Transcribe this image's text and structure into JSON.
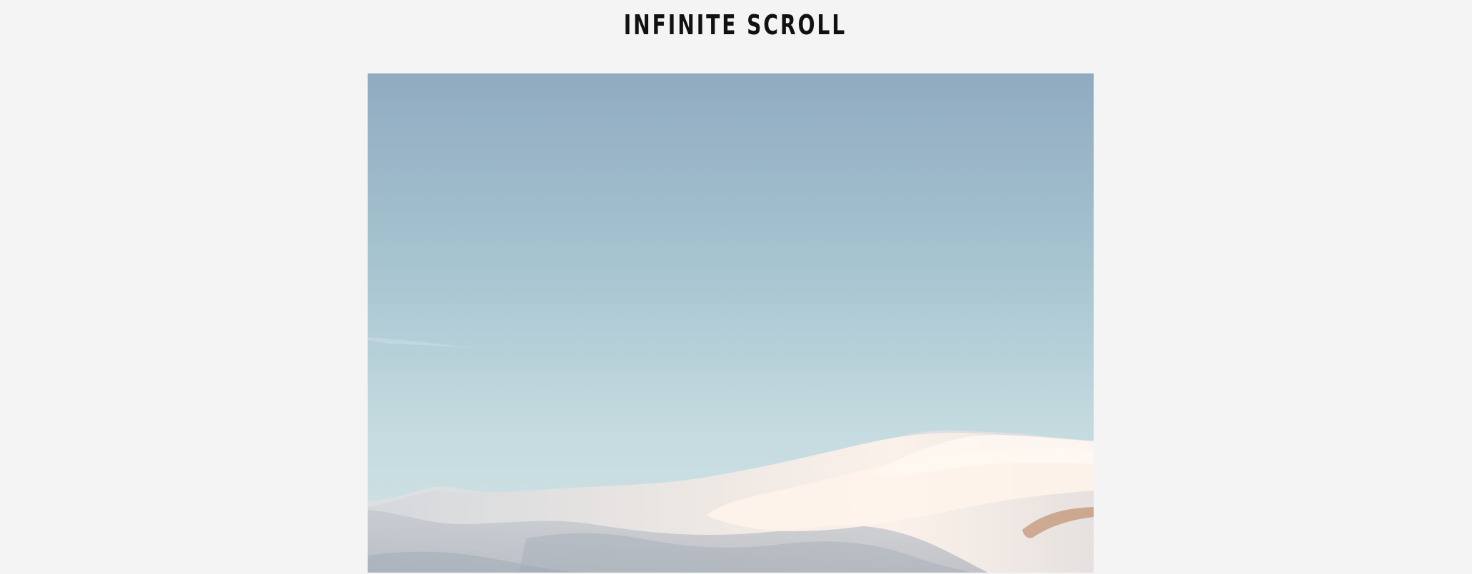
{
  "header": {
    "title": "INFINITE SCROLL"
  },
  "feed": {
    "items": [
      {
        "kind": "photo",
        "subject": "snowy-mountain-landscape"
      }
    ]
  },
  "colors": {
    "page_background": "#f4f4f4",
    "title_text": "#111111",
    "sky_top": "#90abc1",
    "sky_horizon": "#cfe2e6",
    "snow": "#f1e8e4"
  }
}
